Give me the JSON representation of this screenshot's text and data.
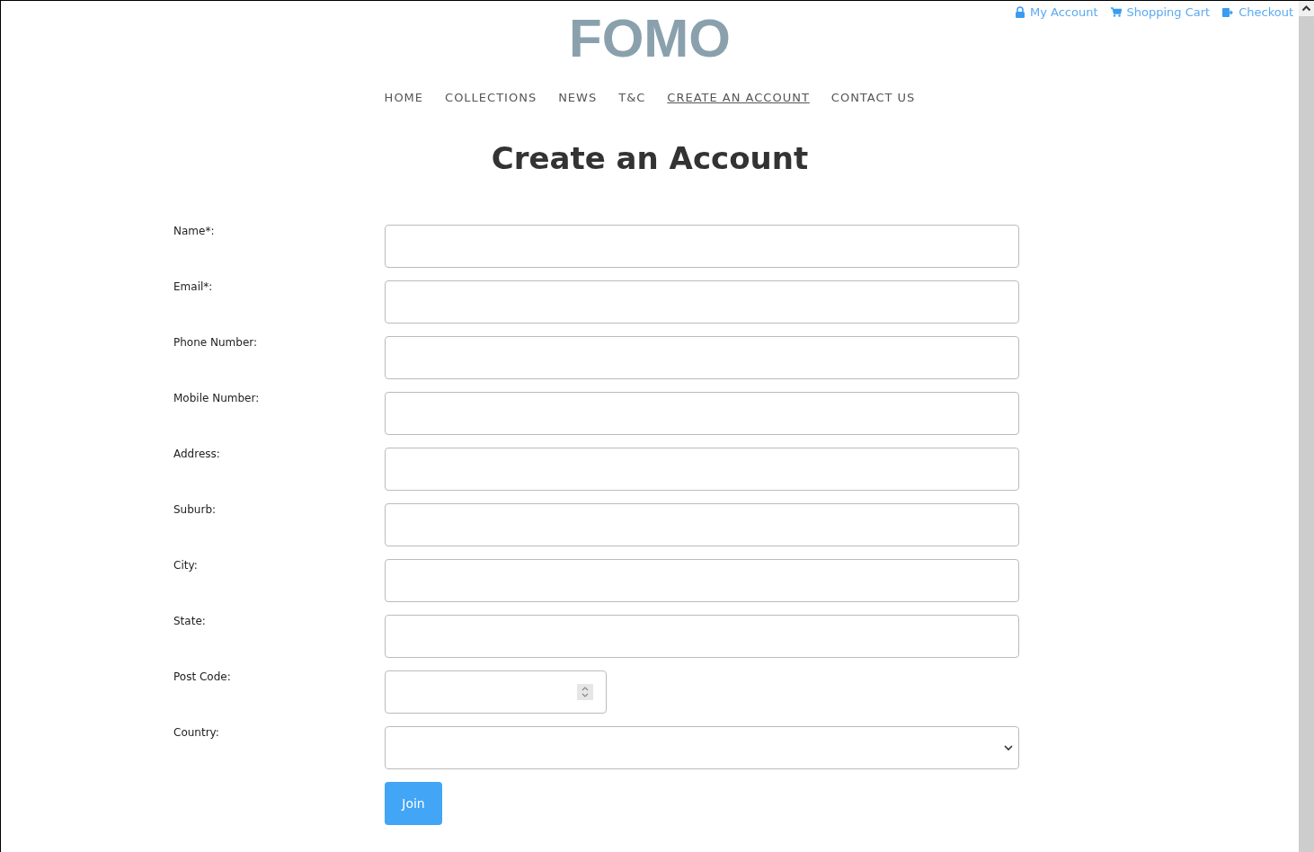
{
  "top_links": [
    {
      "kind": "lock",
      "label": "My Account"
    },
    {
      "kind": "cart",
      "label": "Shopping Cart"
    },
    {
      "kind": "checkout",
      "label": "Checkout"
    }
  ],
  "logo": "FOMO",
  "nav": [
    {
      "label": "HOME",
      "selected": false
    },
    {
      "label": "COLLECTIONS",
      "selected": false
    },
    {
      "label": "NEWS",
      "selected": false
    },
    {
      "label": "T&C",
      "selected": false
    },
    {
      "label": "CREATE AN ACCOUNT",
      "selected": true
    },
    {
      "label": "CONTACT US",
      "selected": false
    }
  ],
  "heading": "Create an Account",
  "fields": [
    {
      "label": "Name*:",
      "kind": "text"
    },
    {
      "label": "Email*:",
      "kind": "text"
    },
    {
      "label": "Phone Number:",
      "kind": "text"
    },
    {
      "label": "Mobile Number:",
      "kind": "text"
    },
    {
      "label": "Address:",
      "kind": "text"
    },
    {
      "label": "Suburb:",
      "kind": "text"
    },
    {
      "label": "City:",
      "kind": "text"
    },
    {
      "label": "State:",
      "kind": "text"
    },
    {
      "label": "Post Code:",
      "kind": "number"
    },
    {
      "label": "Country:",
      "kind": "select"
    }
  ],
  "submit": "Join"
}
